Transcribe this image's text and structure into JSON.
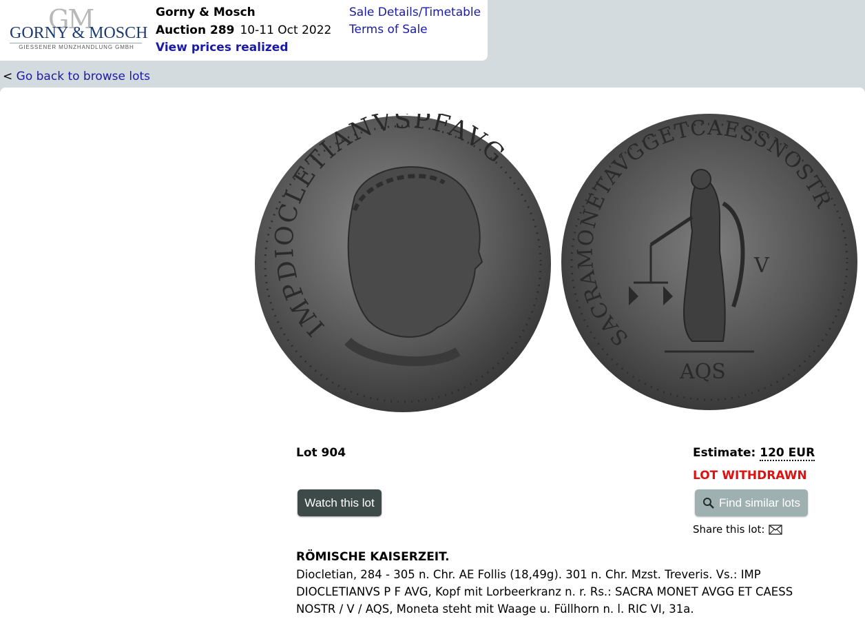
{
  "logo": {
    "monogram": "GM",
    "name": "GORNY & MOSCH",
    "tagline": "GIESSENER MÜNZHANDLUNG GMBH"
  },
  "header": {
    "house": "Gorny & Mosch",
    "auction_label": "Auction 289",
    "auction_date": "10-11 Oct 2022",
    "prices_link": "View prices realized",
    "sale_details_link": "Sale Details/Timetable",
    "terms_link": "Terms of Sale"
  },
  "nav": {
    "back_prefix": "<",
    "back_link": "Go back to browse lots"
  },
  "lot": {
    "number": "Lot 904",
    "estimate_label": "Estimate:",
    "estimate_value": "120 EUR",
    "status": "LOT WITHDRAWN",
    "watch_button": "Watch this lot",
    "find_similar_button": "Find similar lots",
    "share_label": "Share this lot:",
    "category": "RÖMISCHE KAISERZEIT.",
    "description": "Diocletian, 284 - 305 n. Chr. AE Follis (18,49g). 301 n. Chr. Mzst. Treveris. Vs.: IMP DIOCLETIANVS P F AVG, Kopf mit Lorbeerkranz n. r. Rs.: SACRA MONET AVGG ET CAESS NOSTR / V / AQS, Moneta steht mit Waage u. Füllhorn n. l. RIC VI, 31a."
  },
  "coins": {
    "obverse_legend": "IMPDIOCLETIANVSPFAVG",
    "reverse_legend": "SACRAMONETAVGGETCAESSNOSTR",
    "reverse_field": "V",
    "reverse_exergue": "AQS"
  },
  "colors": {
    "link": "#1a1aa6",
    "withdrawn": "#e01010",
    "watch_button_bg": "#3e4a47",
    "find_button_bg": "#9fb0b0",
    "page_bg": "#d4dbde"
  },
  "icons": {
    "find": "magnifier-icon",
    "share": "envelope-icon"
  }
}
